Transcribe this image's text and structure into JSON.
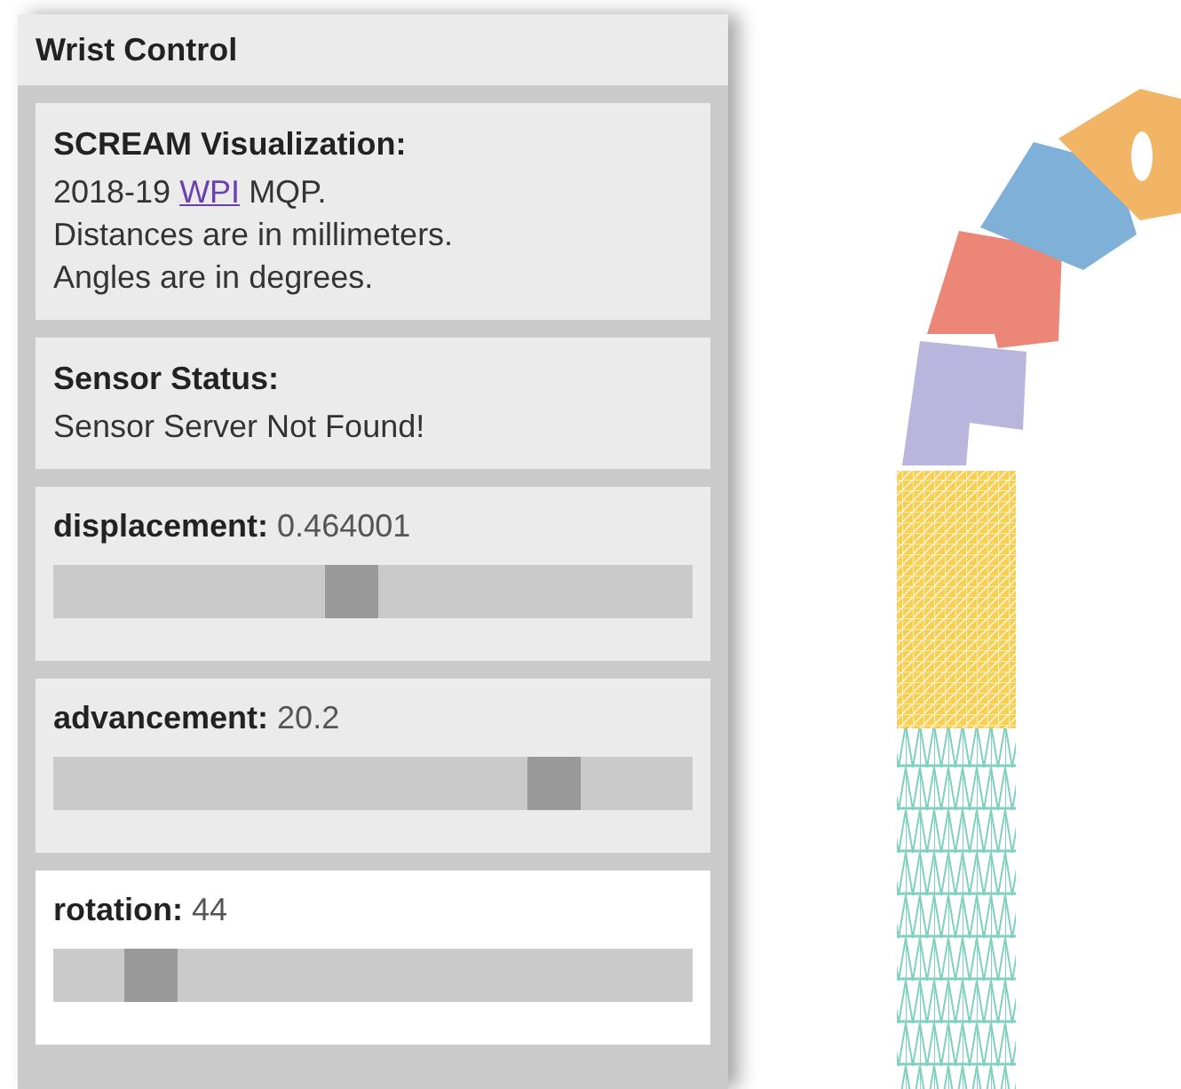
{
  "panel": {
    "title": "Wrist Control"
  },
  "info": {
    "heading": "SCREAM Visualization:",
    "lines": [
      {
        "before": "2018-19 ",
        "link": "WPI",
        "after": " MQP."
      },
      {
        "text": "Distances are in millimeters."
      },
      {
        "text": "Angles are in degrees."
      }
    ]
  },
  "status": {
    "heading": "Sensor Status:",
    "message": "Sensor Server Not Found!"
  },
  "controls": [
    {
      "name": "displacement:",
      "value": "0.464001",
      "level": 0.465,
      "active": false
    },
    {
      "name": "advancement:",
      "value": "20.2",
      "level": 0.81,
      "active": false
    },
    {
      "name": "rotation:",
      "value": "44",
      "level": 0.12,
      "active": true
    }
  ]
}
